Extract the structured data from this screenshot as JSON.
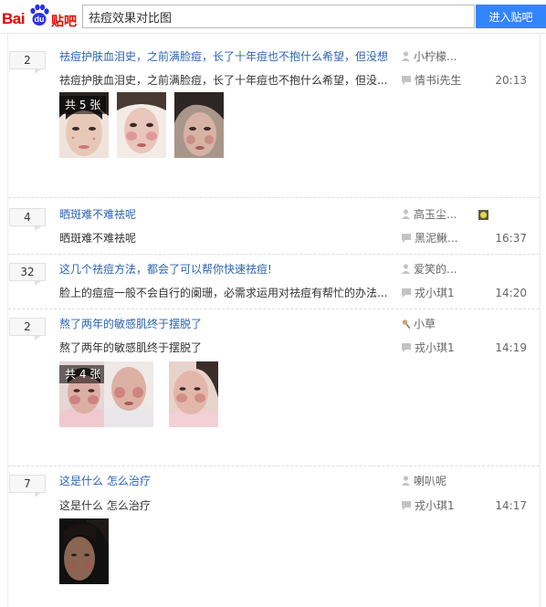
{
  "header": {
    "logo_text_left": "Bai",
    "logo_text_right": "贴吧",
    "search_value": "祛痘效果对比图",
    "search_button": "进入贴吧"
  },
  "threads": [
    {
      "reply_count": "2",
      "title": "祛痘护肤血泪史，之前满脸痘，长了十年痘也不抱什么希望，但没想",
      "abstract": "祛痘护肤血泪史，之前满脸痘，长了十年痘也不抱什么希望，但没...",
      "author": "小柠檬...",
      "last_replier": "情书i先生",
      "time": "20:13",
      "image_count": "共 5 张"
    },
    {
      "reply_count": "4",
      "title": "晒斑难不难祛呢",
      "abstract": "晒斑难不难祛呢",
      "author": "高玉尘...",
      "last_replier": "黑泥鳅...",
      "time": "16:37"
    },
    {
      "reply_count": "32",
      "title": "这几个祛痘方法，都会了可以帮你快速祛痘!",
      "abstract": "脸上的痘痘一般不会自行的阑珊，必需求运用对祛痘有帮忙的办法...",
      "author": "爱笑的...",
      "last_replier": "戎小琪1",
      "time": "14:20"
    },
    {
      "reply_count": "2",
      "title": "熬了两年的敏感肌终于摆脱了",
      "abstract": "熬了两年的敏感肌终于摆脱了",
      "author": "小草",
      "last_replier": "戎小琪1",
      "time": "14:19",
      "image_count": "共 4 张"
    },
    {
      "reply_count": "7",
      "title": "这是什么 怎么治疗",
      "abstract": "这是什么 怎么治疗",
      "author": "喇叭呢",
      "last_replier": "戎小琪1",
      "time": "14:17"
    }
  ],
  "colors": {
    "title_link": "#2d64b3",
    "button_blue": "#3385ff",
    "logo_red": "#e10602"
  },
  "icons": [
    "baidu-paw-icon",
    "user-icon",
    "comment-icon",
    "member-badge-icon",
    "leaf-user-icon"
  ]
}
